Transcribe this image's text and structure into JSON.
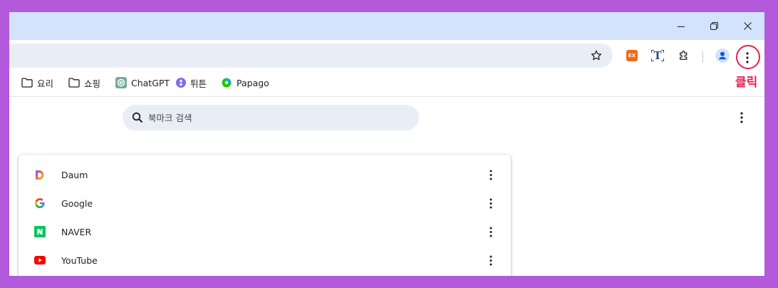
{
  "window": {
    "minimize_glyph": "–",
    "close_glyph": "✕"
  },
  "toolbar": {
    "icons": [
      "star-icon",
      "ex-extension-icon",
      "t-extension-icon",
      "puzzle-icon",
      "profile-icon",
      "kebab-menu-icon"
    ],
    "ext_ex_label": "EX",
    "ext_t_label": "T"
  },
  "annotation": {
    "label": "클릭",
    "color": "#e5204f"
  },
  "bookmarks_bar": [
    {
      "label": "요리",
      "icon": "folder-icon"
    },
    {
      "label": "쇼핑",
      "icon": "folder-icon"
    },
    {
      "label": "ChatGPT",
      "icon": "chatgpt-icon"
    },
    {
      "label": "튀튼",
      "icon": "purple-dot-icon"
    },
    {
      "label": "Papago",
      "icon": "papago-icon"
    }
  ],
  "search": {
    "placeholder": "북마크 검색"
  },
  "bookmarks_list": [
    {
      "title": "Daum",
      "icon": "daum-icon"
    },
    {
      "title": "Google",
      "icon": "google-icon"
    },
    {
      "title": "NAVER",
      "icon": "naver-icon"
    },
    {
      "title": "YouTube",
      "icon": "youtube-icon"
    }
  ],
  "colors": {
    "frame_background": "#b259dc",
    "titlebar": "#d3e3fd",
    "omnibox": "#e9eef6",
    "naver_green": "#03c75a",
    "youtube_red": "#ff0000",
    "ex_orange": "#f06a1a"
  }
}
